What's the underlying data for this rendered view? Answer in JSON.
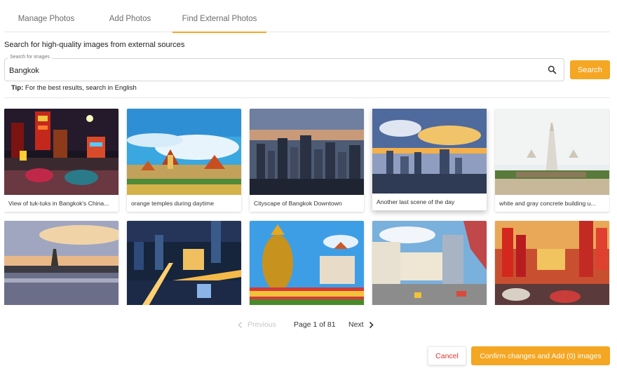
{
  "tabs": [
    {
      "label": "Manage Photos"
    },
    {
      "label": "Add Photos"
    },
    {
      "label": "Find External Photos"
    }
  ],
  "active_tab": "Find External Photos",
  "subtitle": "Search for high-quality images from external sources",
  "search": {
    "legend": "Search for images",
    "value": "Bangkok",
    "button_label": "Search"
  },
  "tip": {
    "label": "Tip:",
    "text": "For the best results, search in English"
  },
  "photos": [
    {
      "caption": "View of tuk-tuks in Bangkok's China..."
    },
    {
      "caption": "orange temples during daytime"
    },
    {
      "caption": "Cityscape of Bangkok Downtown"
    },
    {
      "caption": "Another last scene of the day"
    },
    {
      "caption": "white and gray concrete building u..."
    },
    {
      "caption": ""
    },
    {
      "caption": ""
    },
    {
      "caption": ""
    },
    {
      "caption": ""
    },
    {
      "caption": ""
    }
  ],
  "pagination": {
    "prev_label": "Previous",
    "info": "Page 1 of 81",
    "next_label": "Next"
  },
  "footer": {
    "cancel_label": "Cancel",
    "confirm_label": "Confirm changes and Add (0) images"
  },
  "colors": {
    "accent": "#f5a623",
    "cancel_text": "#e0332e"
  }
}
